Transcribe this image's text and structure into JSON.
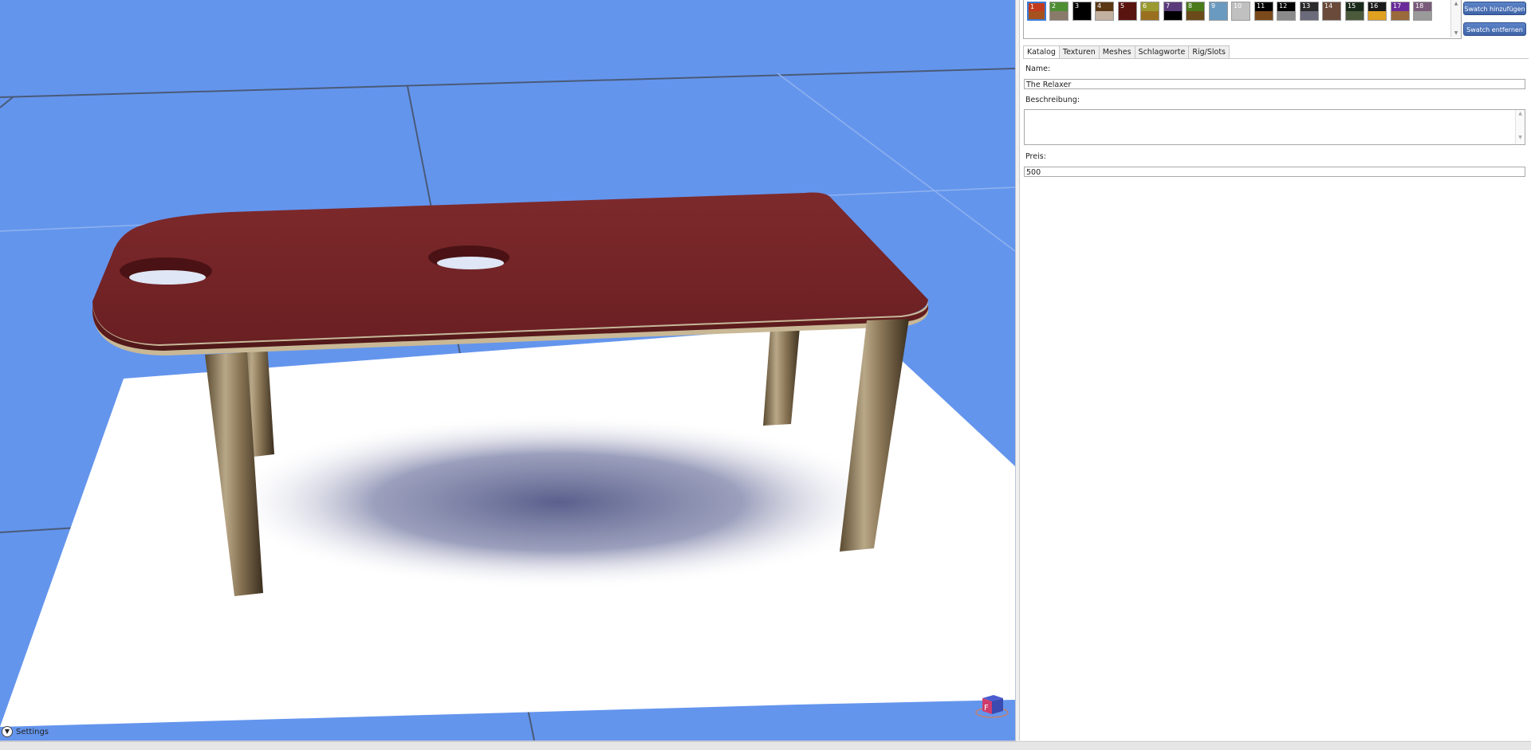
{
  "viewport": {
    "settings_label": "Settings",
    "view_cube_label": "F",
    "colors": {
      "background": "#6495ed",
      "floor": "#ffffff",
      "tabletop": "#7a2628",
      "legs": "#8a7a5e",
      "shadow": "#4a5080"
    }
  },
  "swatches": {
    "items": [
      {
        "label": "1",
        "top": "#c23a1d",
        "bottom": "#a5521f",
        "selected": true
      },
      {
        "label": "2",
        "top": "#4e8f34",
        "bottom": "#8a7a6a"
      },
      {
        "label": "3",
        "top": "#000000",
        "bottom": "#000000"
      },
      {
        "label": "4",
        "top": "#5a3814",
        "bottom": "#c2b0a0"
      },
      {
        "label": "5",
        "top": "#5a1410",
        "bottom": "#5a1410"
      },
      {
        "label": "6",
        "top": "#9a9a30",
        "bottom": "#9a7020"
      },
      {
        "label": "7",
        "top": "#5a3a7a",
        "bottom": "#000000"
      },
      {
        "label": "8",
        "top": "#4a7a1a",
        "bottom": "#6a4a1a"
      },
      {
        "label": "9",
        "top": "#6a9ac0",
        "bottom": "#6a9ac0"
      },
      {
        "label": "10",
        "top": "#c0c0c0",
        "bottom": "#c0c0c0"
      },
      {
        "label": "11",
        "top": "#000000",
        "bottom": "#7a4a1a"
      },
      {
        "label": "12",
        "top": "#000000",
        "bottom": "#8a8a8a"
      },
      {
        "label": "13",
        "top": "#2a2a2a",
        "bottom": "#6a6a7a"
      },
      {
        "label": "14",
        "top": "#6a4a3a",
        "bottom": "#6a4a3a"
      },
      {
        "label": "15",
        "top": "#1a2a1a",
        "bottom": "#4a5a3a"
      },
      {
        "label": "16",
        "top": "#1a1a1a",
        "bottom": "#e0a020"
      },
      {
        "label": "17",
        "top": "#6a2a9a",
        "bottom": "#9a6a3a"
      },
      {
        "label": "18",
        "top": "#7a5a7a",
        "bottom": "#9a9a9a"
      }
    ],
    "add_button": "Swatch hinzufügen",
    "remove_button": "Swatch entfernen"
  },
  "tabs": [
    "Katalog",
    "Texturen",
    "Meshes",
    "Schlagworte",
    "Rig/Slots"
  ],
  "katalog": {
    "name_label": "Name:",
    "name_value": "The Relaxer",
    "description_label": "Beschreibung:",
    "description_value": "",
    "price_label": "Preis:",
    "price_value": "500"
  }
}
